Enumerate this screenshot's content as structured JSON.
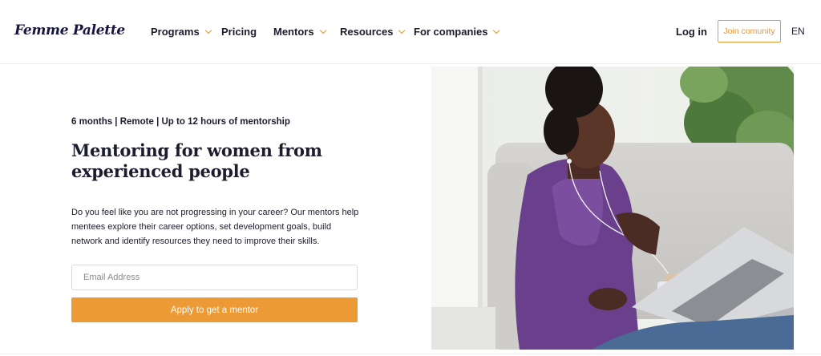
{
  "brand": {
    "name": "Femme Palette"
  },
  "nav": {
    "items": [
      {
        "label": "Programs",
        "dropdown": true
      },
      {
        "label": "Pricing",
        "dropdown": false
      },
      {
        "label": "Mentors",
        "dropdown": true
      },
      {
        "label": "Resources",
        "dropdown": true
      },
      {
        "label": "For companies",
        "dropdown": true
      }
    ],
    "login_label": "Log in",
    "join_label": "Join comunity",
    "language": "EN"
  },
  "hero": {
    "meta": "6 months | Remote | Up to 12 hours of mentorship",
    "title": "Mentoring for women from experienced people",
    "description": "Do you feel like you are not progressing in your career? Our mentors help mentees explore their career options, set development goals, build network and identify resources they need to improve their skills.",
    "email_placeholder": "Email Address",
    "cta_label": "Apply to get a mentor"
  },
  "colors": {
    "accent": "#ec9a35",
    "text": "#1c1c2e",
    "brand": "#17153f"
  },
  "icons": [
    "chevron-down-icon"
  ]
}
